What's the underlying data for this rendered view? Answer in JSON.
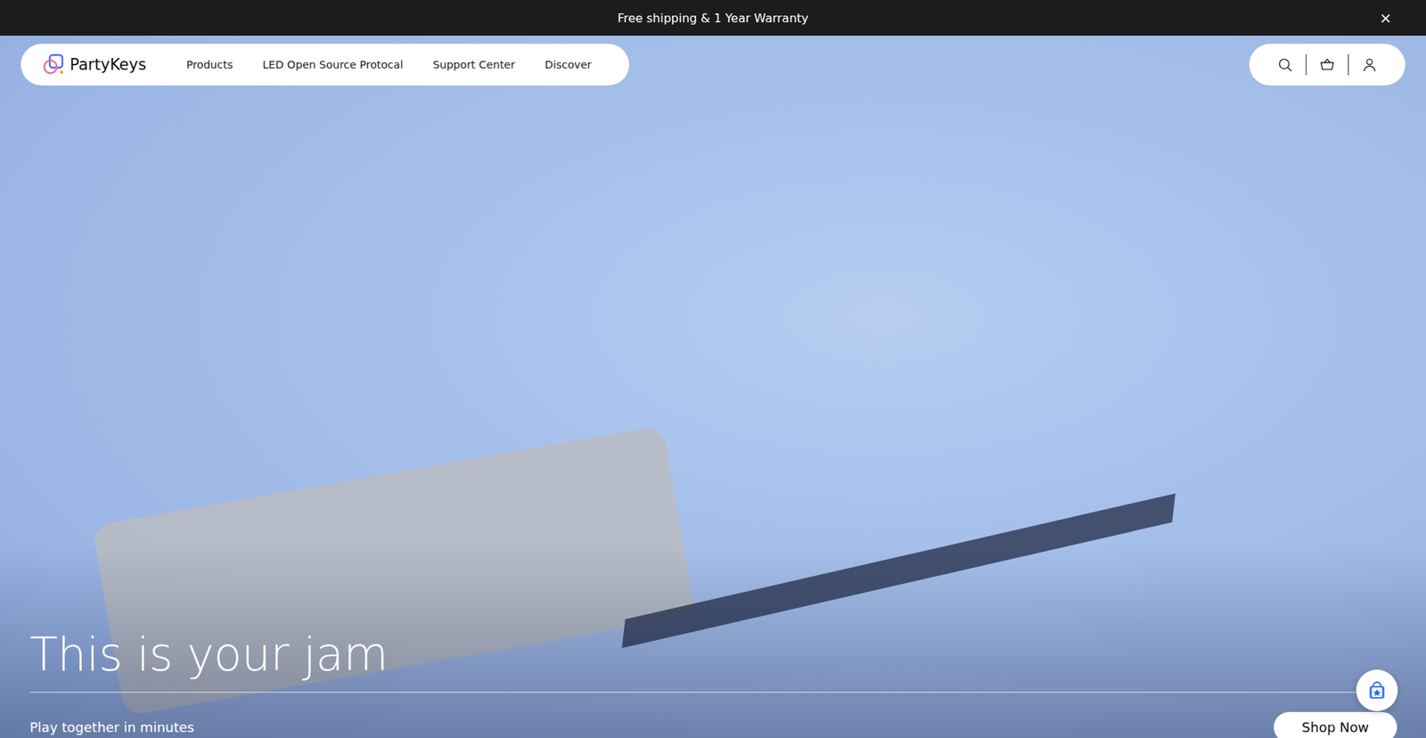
{
  "announcement": {
    "text": "Free shipping & 1 Year Warranty",
    "close": "×"
  },
  "brand": "PartyKeys",
  "nav": [
    {
      "label": "Products"
    },
    {
      "label": "LED Open Source Protocal"
    },
    {
      "label": "Support Center"
    },
    {
      "label": "Discover"
    }
  ],
  "hero": {
    "title": "This is your jam",
    "subtitle": "Play together in minutes",
    "button": "Shop Now"
  }
}
